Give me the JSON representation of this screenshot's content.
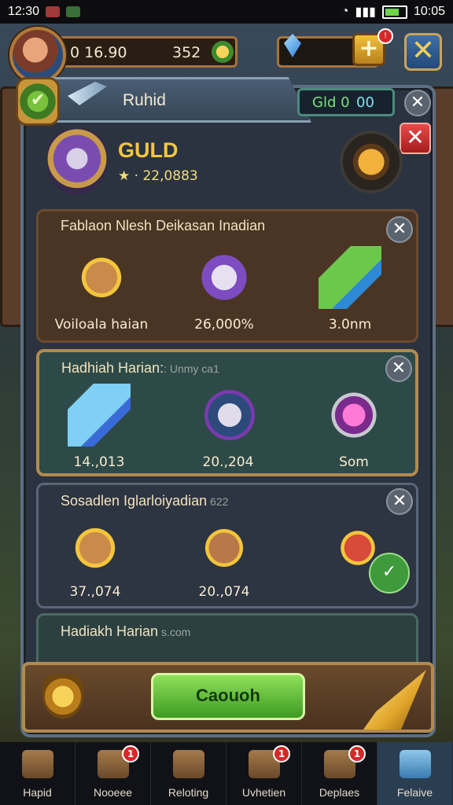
{
  "status_bar": {
    "time_left": "12:30",
    "time_right": "10:05"
  },
  "top": {
    "currency_a": "0 16.90",
    "currency_b": "352",
    "plus_badge": "!"
  },
  "panel": {
    "title": "Ruhid",
    "gold_label": "Gld 0",
    "gold_value": "00",
    "guild_name": "GULD",
    "guild_stat": "★ · 22,0883"
  },
  "sections": [
    {
      "title": "Fablaon Nlesh Deikasan Inadian",
      "subtitle": "",
      "items": [
        {
          "icon": "fox-coin-icon",
          "value": "Voiloala haian"
        },
        {
          "icon": "cat-emblem-icon",
          "value": "26,000%"
        },
        {
          "icon": "potion-icon",
          "value": "3.0nm"
        }
      ]
    },
    {
      "title": "Hadhiah Harian:",
      "subtitle": ": Unmy ca1",
      "items": [
        {
          "icon": "crystal-icon",
          "value": "14.,013"
        },
        {
          "icon": "wizard-cat-icon",
          "value": "20.,204"
        },
        {
          "icon": "gem-frame-icon",
          "value": "Som"
        }
      ]
    },
    {
      "title": "Sosadlen Iglarloiyadian",
      "subtitle": " 622",
      "items": [
        {
          "icon": "fox-coin-icon",
          "value": "37.,074"
        },
        {
          "icon": "fox-badge-icon",
          "value": "20.,074"
        },
        {
          "icon": "gift-box-icon",
          "value": ""
        }
      ]
    },
    {
      "title": "Hadiakh Harian",
      "subtitle": " s.com",
      "items": []
    }
  ],
  "footer": {
    "claim_label": "Caouoh"
  },
  "nav": [
    {
      "label": "Hapid",
      "badge": ""
    },
    {
      "label": "Nooeee",
      "badge": "1"
    },
    {
      "label": "Reloting",
      "badge": ""
    },
    {
      "label": "Uvhetien",
      "badge": "1"
    },
    {
      "label": "Deplaes",
      "badge": "1"
    },
    {
      "label": "Felaive",
      "badge": ""
    }
  ]
}
